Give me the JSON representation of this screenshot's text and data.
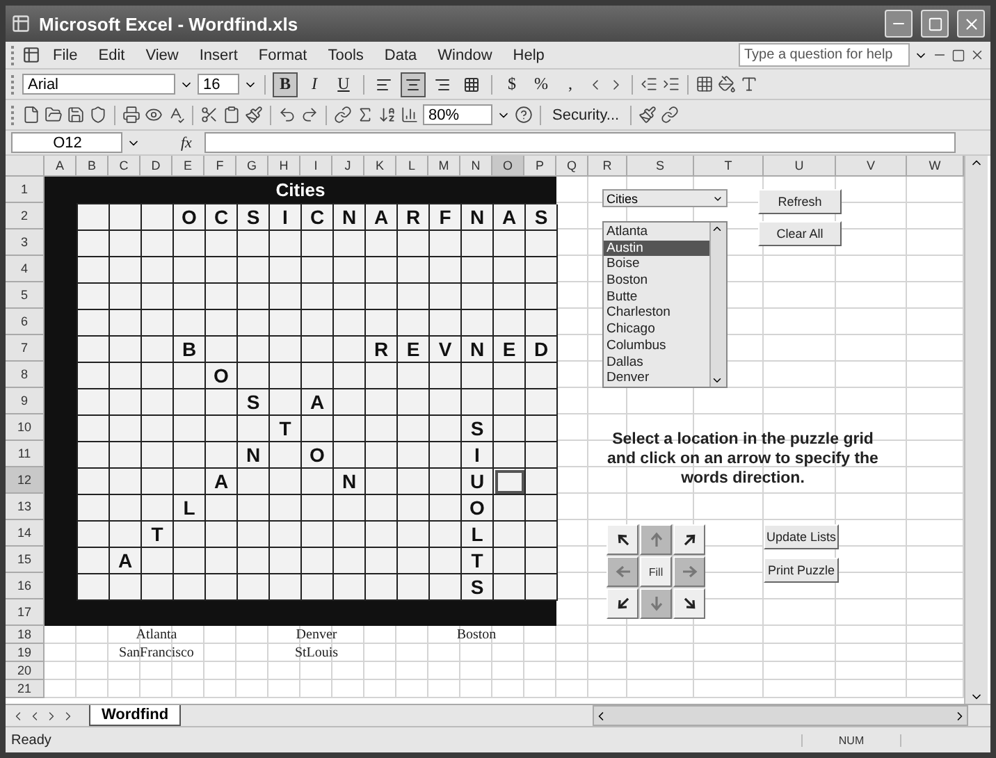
{
  "window": {
    "title": "Microsoft Excel - Wordfind.xls"
  },
  "menu": [
    "File",
    "Edit",
    "View",
    "Insert",
    "Format",
    "Tools",
    "Data",
    "Window",
    "Help"
  ],
  "help_box": {
    "placeholder": "Type a question for help"
  },
  "format_toolbar": {
    "font": "Arial",
    "size": "16",
    "style_buttons": [
      {
        "label": "B",
        "on": true
      },
      {
        "label": "I",
        "on": false
      },
      {
        "label": "U",
        "on": false
      }
    ],
    "align_buttons": [
      {
        "on": false
      },
      {
        "on": true
      },
      {
        "on": false
      },
      {
        "on": false
      }
    ],
    "number_buttons": [
      "$",
      "%",
      ","
    ]
  },
  "standard_toolbar": {
    "zoom": "80%",
    "security": "Security..."
  },
  "formula_bar": {
    "name_box": "O12",
    "fx": "fx"
  },
  "columns": [
    "A",
    "B",
    "C",
    "D",
    "E",
    "F",
    "G",
    "H",
    "I",
    "J",
    "K",
    "L",
    "M",
    "N",
    "O",
    "P",
    "Q",
    "R",
    "S",
    "T",
    "U",
    "V",
    "W"
  ],
  "rows": [
    "1",
    "2",
    "3",
    "4",
    "5",
    "6",
    "7",
    "8",
    "9",
    "10",
    "11",
    "12",
    "13",
    "14",
    "15",
    "16",
    "17",
    "18",
    "19",
    "20",
    "21"
  ],
  "puzzle": {
    "title": "Cities",
    "grid": [
      {
        "cells": [
          {
            "selected": false
          },
          {
            "selected": false
          },
          {
            "selected": false
          },
          {
            "letter": "O",
            "selected": false
          },
          {
            "letter": "C",
            "selected": false
          },
          {
            "letter": "S",
            "selected": false
          },
          {
            "letter": "I",
            "selected": false
          },
          {
            "letter": "C",
            "selected": false
          },
          {
            "letter": "N",
            "selected": false
          },
          {
            "letter": "A",
            "selected": false
          },
          {
            "letter": "R",
            "selected": false
          },
          {
            "letter": "F",
            "selected": false
          },
          {
            "letter": "N",
            "selected": false
          },
          {
            "letter": "A",
            "selected": false
          },
          {
            "letter": "S",
            "selected": false
          }
        ]
      },
      {
        "cells": [
          {
            "selected": false
          },
          {
            "selected": false
          },
          {
            "selected": false
          },
          {
            "selected": false
          },
          {
            "selected": false
          },
          {
            "selected": false
          },
          {
            "selected": false
          },
          {
            "selected": false
          },
          {
            "selected": false
          },
          {
            "selected": false
          },
          {
            "selected": false
          },
          {
            "selected": false
          },
          {
            "selected": false
          },
          {
            "selected": false
          },
          {
            "selected": false
          }
        ]
      },
      {
        "cells": [
          {
            "selected": false
          },
          {
            "selected": false
          },
          {
            "selected": false
          },
          {
            "selected": false
          },
          {
            "selected": false
          },
          {
            "selected": false
          },
          {
            "selected": false
          },
          {
            "selected": false
          },
          {
            "selected": false
          },
          {
            "selected": false
          },
          {
            "selected": false
          },
          {
            "selected": false
          },
          {
            "selected": false
          },
          {
            "selected": false
          },
          {
            "selected": false
          }
        ]
      },
      {
        "cells": [
          {
            "selected": false
          },
          {
            "selected": false
          },
          {
            "selected": false
          },
          {
            "selected": false
          },
          {
            "selected": false
          },
          {
            "selected": false
          },
          {
            "selected": false
          },
          {
            "selected": false
          },
          {
            "selected": false
          },
          {
            "selected": false
          },
          {
            "selected": false
          },
          {
            "selected": false
          },
          {
            "selected": false
          },
          {
            "selected": false
          },
          {
            "selected": false
          }
        ]
      },
      {
        "cells": [
          {
            "selected": false
          },
          {
            "selected": false
          },
          {
            "selected": false
          },
          {
            "selected": false
          },
          {
            "selected": false
          },
          {
            "selected": false
          },
          {
            "selected": false
          },
          {
            "selected": false
          },
          {
            "selected": false
          },
          {
            "selected": false
          },
          {
            "selected": false
          },
          {
            "selected": false
          },
          {
            "selected": false
          },
          {
            "selected": false
          },
          {
            "selected": false
          }
        ]
      },
      {
        "cells": [
          {
            "selected": false
          },
          {
            "selected": false
          },
          {
            "selected": false
          },
          {
            "letter": "B",
            "selected": false
          },
          {
            "selected": false
          },
          {
            "selected": false
          },
          {
            "selected": false
          },
          {
            "selected": false
          },
          {
            "selected": false
          },
          {
            "letter": "R",
            "selected": false
          },
          {
            "letter": "E",
            "selected": false
          },
          {
            "letter": "V",
            "selected": false
          },
          {
            "letter": "N",
            "selected": false
          },
          {
            "letter": "E",
            "selected": false
          },
          {
            "letter": "D",
            "selected": false
          }
        ]
      },
      {
        "cells": [
          {
            "selected": false
          },
          {
            "selected": false
          },
          {
            "selected": false
          },
          {
            "selected": false
          },
          {
            "letter": "O",
            "selected": false
          },
          {
            "selected": false
          },
          {
            "selected": false
          },
          {
            "selected": false
          },
          {
            "selected": false
          },
          {
            "selected": false
          },
          {
            "selected": false
          },
          {
            "selected": false
          },
          {
            "selected": false
          },
          {
            "selected": false
          },
          {
            "selected": false
          }
        ]
      },
      {
        "cells": [
          {
            "selected": false
          },
          {
            "selected": false
          },
          {
            "selected": false
          },
          {
            "selected": false
          },
          {
            "selected": false
          },
          {
            "letter": "S",
            "selected": false
          },
          {
            "selected": false
          },
          {
            "letter": "A",
            "selected": false
          },
          {
            "selected": false
          },
          {
            "selected": false
          },
          {
            "selected": false
          },
          {
            "selected": false
          },
          {
            "selected": false
          },
          {
            "selected": false
          },
          {
            "selected": false
          }
        ]
      },
      {
        "cells": [
          {
            "selected": false
          },
          {
            "selected": false
          },
          {
            "selected": false
          },
          {
            "selected": false
          },
          {
            "selected": false
          },
          {
            "selected": false
          },
          {
            "letter": "T",
            "selected": false
          },
          {
            "selected": false
          },
          {
            "selected": false
          },
          {
            "selected": false
          },
          {
            "selected": false
          },
          {
            "selected": false
          },
          {
            "letter": "S",
            "selected": false
          },
          {
            "selected": false
          },
          {
            "selected": false
          }
        ]
      },
      {
        "cells": [
          {
            "selected": false
          },
          {
            "selected": false
          },
          {
            "selected": false
          },
          {
            "selected": false
          },
          {
            "selected": false
          },
          {
            "letter": "N",
            "selected": false
          },
          {
            "selected": false
          },
          {
            "letter": "O",
            "selected": false
          },
          {
            "selected": false
          },
          {
            "selected": false
          },
          {
            "selected": false
          },
          {
            "selected": false
          },
          {
            "letter": "I",
            "selected": false
          },
          {
            "selected": false
          },
          {
            "selected": false
          }
        ]
      },
      {
        "cells": [
          {
            "selected": false
          },
          {
            "selected": false
          },
          {
            "selected": false
          },
          {
            "selected": false
          },
          {
            "letter": "A",
            "selected": false
          },
          {
            "selected": false
          },
          {
            "selected": false
          },
          {
            "selected": false
          },
          {
            "letter": "N",
            "selected": false
          },
          {
            "selected": false
          },
          {
            "selected": false
          },
          {
            "selected": false
          },
          {
            "letter": "U",
            "selected": false
          },
          {
            "selected": true
          },
          {
            "selected": false
          }
        ]
      },
      {
        "cells": [
          {
            "selected": false
          },
          {
            "selected": false
          },
          {
            "selected": false
          },
          {
            "letter": "L",
            "selected": false
          },
          {
            "selected": false
          },
          {
            "selected": false
          },
          {
            "selected": false
          },
          {
            "selected": false
          },
          {
            "selected": false
          },
          {
            "selected": false
          },
          {
            "selected": false
          },
          {
            "selected": false
          },
          {
            "letter": "O",
            "selected": false
          },
          {
            "selected": false
          },
          {
            "selected": false
          }
        ]
      },
      {
        "cells": [
          {
            "selected": false
          },
          {
            "selected": false
          },
          {
            "letter": "T",
            "selected": false
          },
          {
            "selected": false
          },
          {
            "selected": false
          },
          {
            "selected": false
          },
          {
            "selected": false
          },
          {
            "selected": false
          },
          {
            "selected": false
          },
          {
            "selected": false
          },
          {
            "selected": false
          },
          {
            "selected": false
          },
          {
            "letter": "L",
            "selected": false
          },
          {
            "selected": false
          },
          {
            "selected": false
          }
        ]
      },
      {
        "cells": [
          {
            "selected": false
          },
          {
            "letter": "A",
            "selected": false
          },
          {
            "selected": false
          },
          {
            "selected": false
          },
          {
            "selected": false
          },
          {
            "selected": false
          },
          {
            "selected": false
          },
          {
            "selected": false
          },
          {
            "selected": false
          },
          {
            "selected": false
          },
          {
            "selected": false
          },
          {
            "selected": false
          },
          {
            "letter": "T",
            "selected": false
          },
          {
            "selected": false
          },
          {
            "selected": false
          }
        ]
      },
      {
        "cells": [
          {
            "selected": false
          },
          {
            "selected": false
          },
          {
            "selected": false
          },
          {
            "selected": false
          },
          {
            "selected": false
          },
          {
            "selected": false
          },
          {
            "selected": false
          },
          {
            "selected": false
          },
          {
            "selected": false
          },
          {
            "selected": false
          },
          {
            "selected": false
          },
          {
            "selected": false
          },
          {
            "letter": "S",
            "selected": false
          },
          {
            "selected": false
          },
          {
            "selected": false
          }
        ]
      }
    ]
  },
  "word_list": [
    [
      "Atlanta",
      "Denver",
      "Boston"
    ],
    [
      "SanFrancisco",
      "StLouis"
    ]
  ],
  "controls": {
    "category": "Cities",
    "city_list": [
      {
        "label": "Atlanta",
        "selected": false
      },
      {
        "label": "Austin",
        "selected": true
      },
      {
        "label": "Boise",
        "selected": false
      },
      {
        "label": "Boston",
        "selected": false
      },
      {
        "label": "Butte",
        "selected": false
      },
      {
        "label": "Charleston",
        "selected": false
      },
      {
        "label": "Chicago",
        "selected": false
      },
      {
        "label": "Columbus",
        "selected": false
      },
      {
        "label": "Dallas",
        "selected": false
      },
      {
        "label": "Denver",
        "selected": false
      }
    ],
    "top_buttons": [
      "Refresh",
      "Clear All"
    ],
    "instruction": "Select a location in the puzzle grid and click on an arrow to specify the words direction.",
    "direction_buttons": [
      {
        "kind": "arrow",
        "disabled": false
      },
      {
        "kind": "arrow",
        "disabled": true
      },
      {
        "kind": "arrow",
        "disabled": false
      },
      {
        "kind": "arrow",
        "disabled": true
      },
      {
        "kind": "fill",
        "label": "Fill",
        "disabled": false
      },
      {
        "kind": "arrow",
        "disabled": true
      },
      {
        "kind": "arrow",
        "disabled": false
      },
      {
        "kind": "arrow",
        "disabled": true
      },
      {
        "kind": "arrow",
        "disabled": false
      }
    ],
    "bottom_buttons": [
      "Update Lists",
      "Print Puzzle"
    ]
  },
  "sheet_tabs": [
    {
      "label": "Wordfind",
      "selected": true
    }
  ],
  "status_bar": {
    "text": "Ready",
    "num": "NUM"
  }
}
